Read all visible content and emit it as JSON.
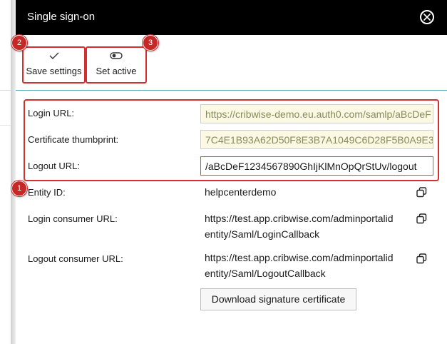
{
  "header": {
    "title": "Single sign-on"
  },
  "toolbar": {
    "save_label": "Save settings",
    "active_label": "Set active"
  },
  "badges": {
    "one": "1",
    "two": "2",
    "three": "3"
  },
  "form": {
    "login_url_label": "Login URL:",
    "login_url_value": "https://cribwise-demo.eu.auth0.com/samlp/aBcDeF",
    "cert_label": "Certificate thumbprint:",
    "cert_value": "7C4E1B93A62D50F8E3B7A1049C6D28F5B0A9E3",
    "logout_url_label": "Logout URL:",
    "logout_url_value": "/aBcDeF1234567890GhIjKlMnOpQrStUv/logout"
  },
  "info": {
    "entity_label": "Entity ID:",
    "entity_value": "helpcenterdemo",
    "login_consumer_label": "Login consumer URL:",
    "login_consumer_line1": "https://test.app.cribwise.com/adminportalid",
    "login_consumer_line2": "entity/Saml/LoginCallback",
    "logout_consumer_label": "Logout consumer URL:",
    "logout_consumer_line1": "https://test.app.cribwise.com/adminportalid",
    "logout_consumer_line2": "entity/Saml/LogoutCallback"
  },
  "download_label": "Download signature certificate",
  "colors": {
    "header": "#000000",
    "highlight": "#d32f2f",
    "accent": "#5aa7b5",
    "field_bg": "#fbf8e4"
  }
}
